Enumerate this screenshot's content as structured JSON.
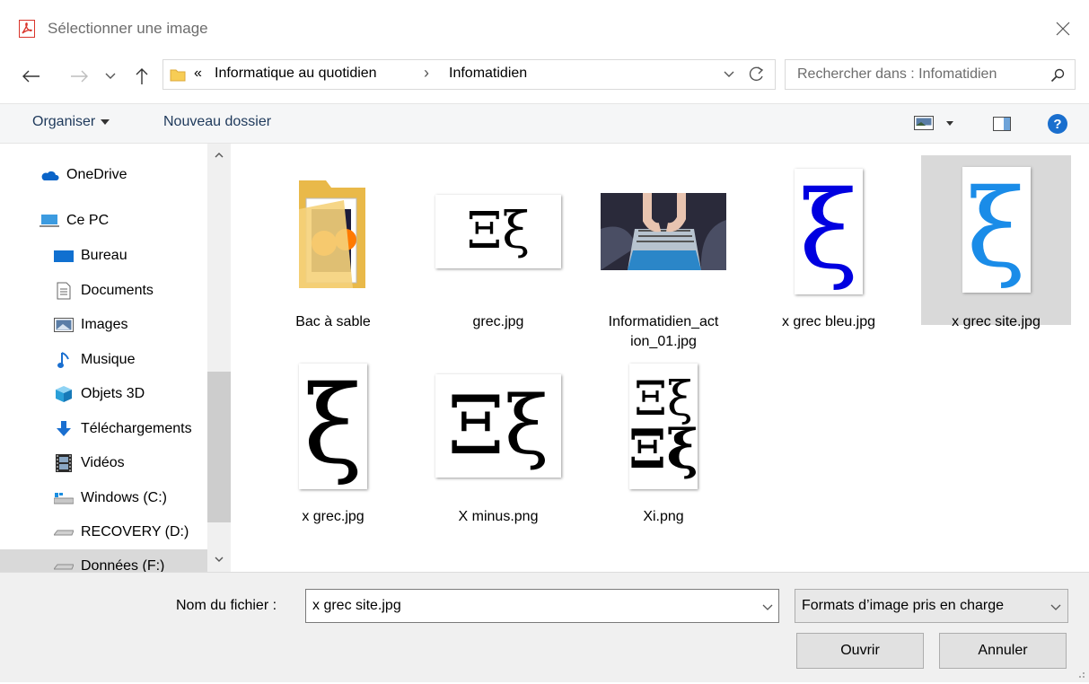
{
  "window": {
    "title": "Sélectionner une image"
  },
  "nav": {
    "path_overflow": "«",
    "breadcrumb": [
      "Informatique au quotidien",
      "Infomatidien"
    ],
    "separator": "›",
    "search_placeholder": "Rechercher dans : Infomatidien"
  },
  "toolbar": {
    "organize": "Organiser",
    "new_folder": "Nouveau dossier"
  },
  "sidebar": {
    "items": [
      {
        "label": "OneDrive",
        "icon": "cloud-icon"
      },
      {
        "label": "Ce PC",
        "icon": "computer-icon"
      },
      {
        "label": "Bureau",
        "icon": "desktop-icon"
      },
      {
        "label": "Documents",
        "icon": "documents-icon"
      },
      {
        "label": "Images",
        "icon": "pictures-icon"
      },
      {
        "label": "Musique",
        "icon": "music-icon"
      },
      {
        "label": "Objets 3D",
        "icon": "cube-icon"
      },
      {
        "label": "Téléchargements",
        "icon": "download-icon"
      },
      {
        "label": "Vidéos",
        "icon": "video-icon"
      },
      {
        "label": "Windows (C:)",
        "icon": "windows-drive-icon"
      },
      {
        "label": "RECOVERY (D:)",
        "icon": "drive-icon"
      },
      {
        "label": "Données (F:)",
        "icon": "drive-icon"
      }
    ]
  },
  "files": [
    {
      "name": "Bac à sable",
      "type": "folder"
    },
    {
      "name": "grec.jpg",
      "type": "image",
      "glyph": "Ξξ"
    },
    {
      "name": "Informatidien_action_01.jpg",
      "name_line1": "Informatidien_act",
      "name_line2": "ion_01.jpg",
      "type": "photo"
    },
    {
      "name": "x grec bleu.jpg",
      "type": "image",
      "glyph": "ξ"
    },
    {
      "name": "x grec site.jpg",
      "type": "image",
      "glyph": "ξ",
      "selected": true
    },
    {
      "name": "x grec.jpg",
      "type": "image",
      "glyph": "ξ"
    },
    {
      "name": "X minus.png",
      "type": "image",
      "glyph": "Ξξ"
    },
    {
      "name": "Xi.png",
      "type": "image",
      "glyph_top": "Ξξ",
      "glyph_bottom": "Ξξ"
    }
  ],
  "bottom": {
    "filename_label": "Nom du fichier :",
    "filename_value": "x grec site.jpg",
    "filetype_value": "Formats d’image pris en charge",
    "open": "Ouvrir",
    "cancel": "Annuler"
  },
  "colors": {
    "accent": "#0078d7",
    "selected": "#d9d9d9",
    "blue_xi": "#0000e0",
    "site_xi": "#1a8ce8",
    "help": "#1a6fce"
  }
}
